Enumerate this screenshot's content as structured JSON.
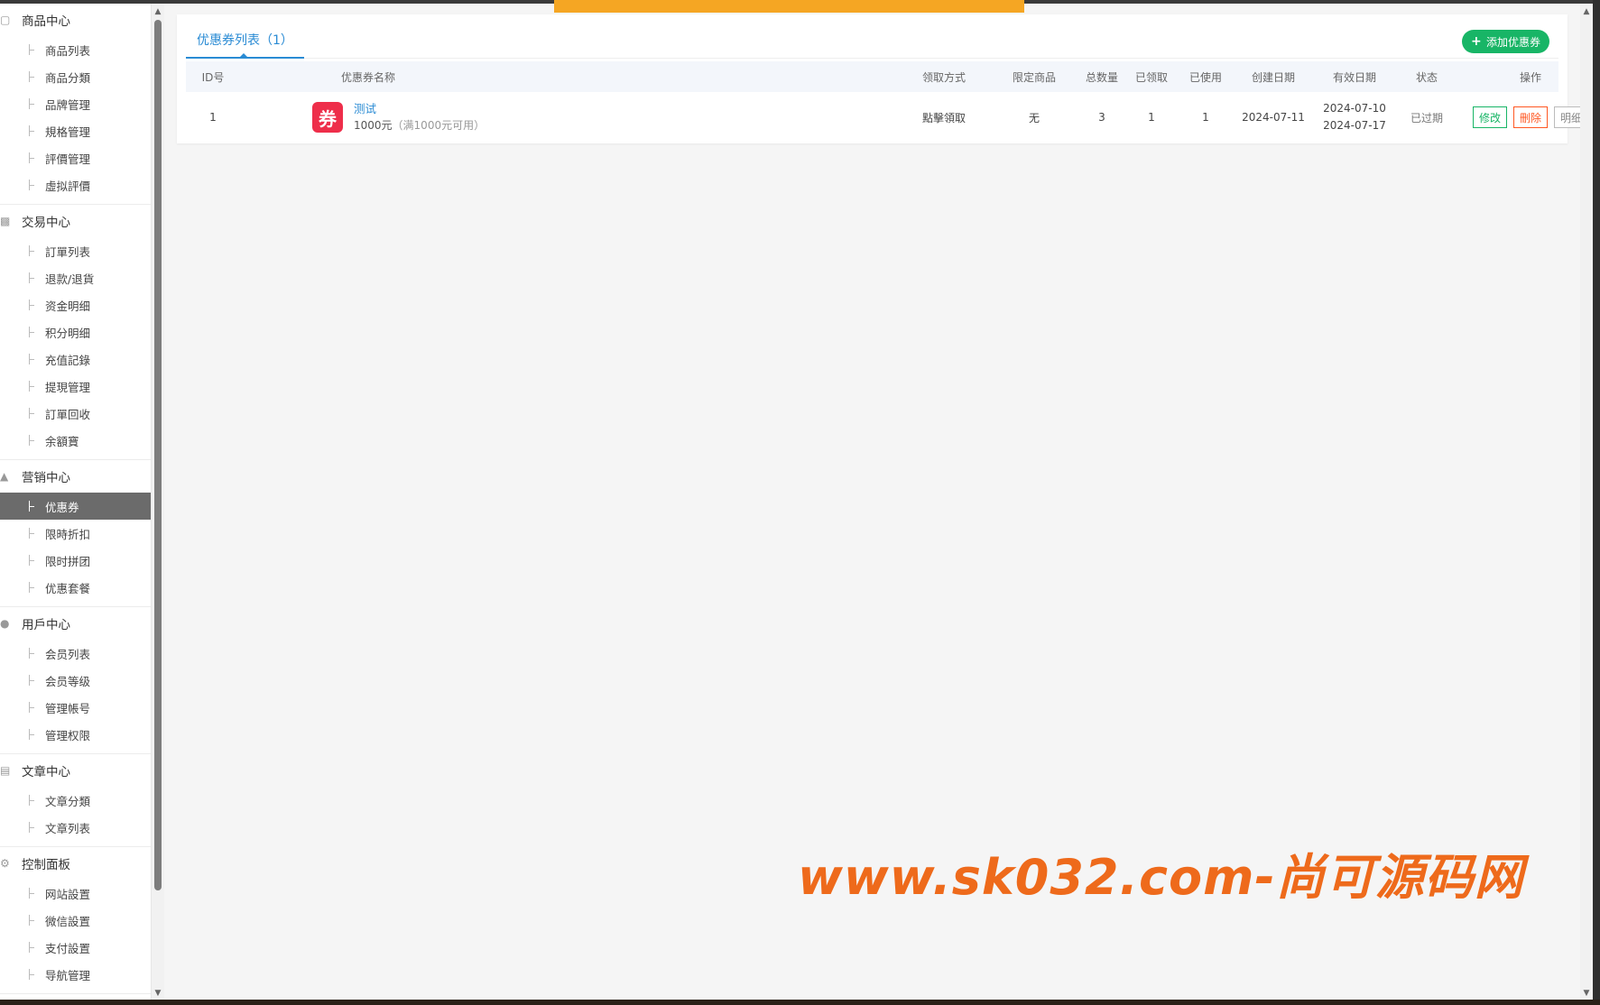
{
  "sidebar": {
    "groups": [
      {
        "title": "商品中心",
        "icon": "box-icon",
        "items": [
          "商品列表",
          "商品分類",
          "品牌管理",
          "規格管理",
          "評價管理",
          "虛拟評價"
        ]
      },
      {
        "title": "交易中心",
        "icon": "bar-chart-icon",
        "items": [
          "訂單列表",
          "退款/退貨",
          "资金明细",
          "积分明细",
          "充值記錄",
          "提現管理",
          "訂單回收",
          "余額寶"
        ]
      },
      {
        "title": "营销中心",
        "icon": "area-chart-icon",
        "items": [
          "优惠券",
          "限時折扣",
          "限时拼团",
          "优惠套餐"
        ]
      },
      {
        "title": "用戶中心",
        "icon": "user-icon",
        "items": [
          "会员列表",
          "会员等级",
          "管理帳号",
          "管理权限"
        ]
      },
      {
        "title": "文章中心",
        "icon": "document-icon",
        "items": [
          "文章分類",
          "文章列表"
        ]
      },
      {
        "title": "控制面板",
        "icon": "gear-icon",
        "items": [
          "网站設置",
          "微信設置",
          "支付設置",
          "导航管理"
        ]
      }
    ],
    "active_item": "优惠券"
  },
  "tab": {
    "label": "优惠券列表（1）"
  },
  "add_button": {
    "label": "添加优惠券"
  },
  "table": {
    "headers": {
      "id": "ID号",
      "name": "优惠券名称",
      "way": "领取方式",
      "limit": "限定商品",
      "total": "总数量",
      "got": "已领取",
      "used": "已使用",
      "created": "创建日期",
      "valid": "有效日期",
      "status": "状态",
      "ops": "操作"
    },
    "rows": [
      {
        "id": "1",
        "icon_char": "券",
        "title": "测试",
        "amount": "1000元",
        "condition": "（满1000元可用）",
        "way": "點擊領取",
        "limit": "无",
        "total": "3",
        "got": "1",
        "used": "1",
        "created": "2024-07-11",
        "valid_start": "2024-07-10",
        "valid_end": "2024-07-17",
        "status": "已过期",
        "op_edit": "修改",
        "op_delete": "刪除",
        "op_detail": "明细"
      }
    ]
  },
  "watermark": "www.sk032.com-尚可源码网",
  "colors": {
    "accent_blue": "#2a8bd4",
    "green": "#18b566",
    "orange": "#ff5722",
    "coupon_red": "#ee2e4a",
    "top_orange": "#f5a623",
    "watermark": "#ee6a1b"
  }
}
